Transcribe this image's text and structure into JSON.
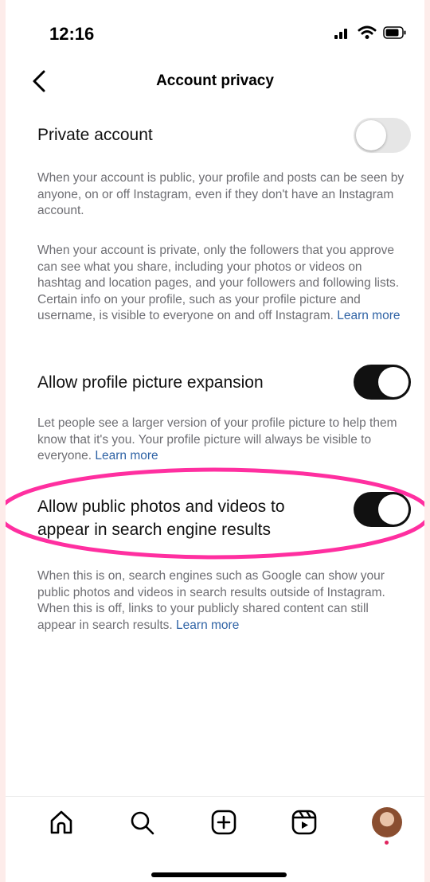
{
  "status_bar": {
    "time": "12:16"
  },
  "header": {
    "title": "Account privacy"
  },
  "settings": {
    "private_account": {
      "label": "Private account",
      "enabled": false,
      "desc_public": "When your account is public, your profile and posts can be seen by anyone, on or off Instagram, even if they don't have an Instagram account.",
      "desc_private": "When your account is private, only the followers that you approve can see what you share, including your photos or videos on hashtag and location pages, and your followers and following lists. Certain info on your profile, such as your profile picture and username, is visible to everyone on and off Instagram.",
      "learn_more": "Learn more"
    },
    "profile_picture_expansion": {
      "label": "Allow profile picture expansion",
      "enabled": true,
      "desc": "Let people see a larger version of your profile picture to help them know that it's you. Your profile picture will always be visible to everyone.",
      "learn_more": "Learn more"
    },
    "search_engine_results": {
      "label_line1": "Allow public photos and videos to",
      "label_line2": "appear in search engine results",
      "enabled": true,
      "desc": "When this is on, search engines such as Google can show your public photos and videos in search results outside of Instagram. When this is off, links to your publicly shared content can still appear in search results.",
      "learn_more": "Learn more"
    }
  },
  "tab_bar": {
    "items": [
      "home-icon",
      "search-icon",
      "create-icon",
      "reels-icon",
      "profile-avatar"
    ]
  },
  "colors": {
    "link": "#2f63a5",
    "toggle_on": "#111111",
    "toggle_off": "#e6e6e6",
    "highlight_ring": "#ff2fa0"
  }
}
